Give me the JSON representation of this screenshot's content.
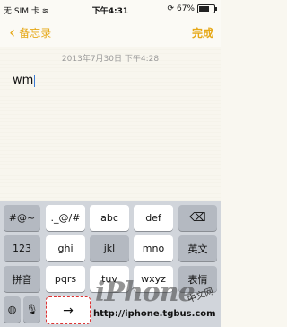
{
  "status": {
    "carrier": "无 SIM 卡",
    "wifi_icon": "wifi-icon",
    "time": "下午4:31",
    "battery": "67%",
    "battery_level": 0.67
  },
  "nav": {
    "back_label": "备忘录",
    "done_label": "完成"
  },
  "note": {
    "date": "2013年7月30日  下午4:28",
    "text": "wm"
  },
  "keyboard": {
    "rows": [
      {
        "left": "#@~",
        "keys": [
          "._@/#",
          "abc",
          "def"
        ],
        "right_icon": "backspace-icon"
      },
      {
        "left": "123",
        "keys": [
          "ghi",
          "jkl",
          "mno"
        ],
        "right": "英文"
      },
      {
        "left": "拼音",
        "keys": [
          "pqrs",
          "tuv",
          "wxyz"
        ],
        "right": "表情"
      },
      {
        "globe_icon": "globe-icon",
        "mic_icon": "mic-icon",
        "return_icon": "arrow-right-icon"
      }
    ]
  },
  "watermark": {
    "brand": "iPhone",
    "url": "http://iphone.tgbus.com",
    "cn": "中文网"
  }
}
